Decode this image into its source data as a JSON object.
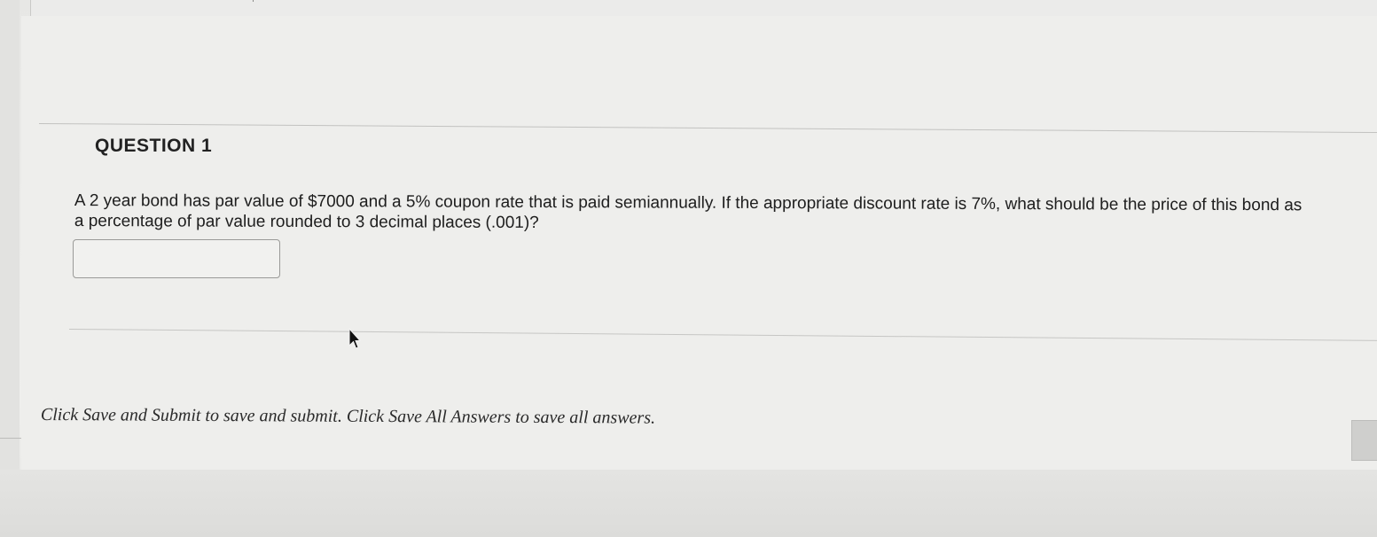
{
  "question": {
    "title": "QUESTION 1",
    "text": "A 2 year bond has par value of $7000 and a 5% coupon rate that is paid semiannually. If the appropriate discount rate is 7%, what should be the price of this bond as a percentage of par value rounded to 3 decimal places (.001)?",
    "answer": {
      "value": "",
      "placeholder": ""
    }
  },
  "footer": {
    "instructions": "Click Save and Submit to save and submit. Click Save All Answers to save all answers."
  },
  "icons": {
    "cursor": "mouse-pointer-icon"
  },
  "colors": {
    "background": "#ececea",
    "text": "#1e1e1e",
    "rule": "#c4c4c2"
  }
}
